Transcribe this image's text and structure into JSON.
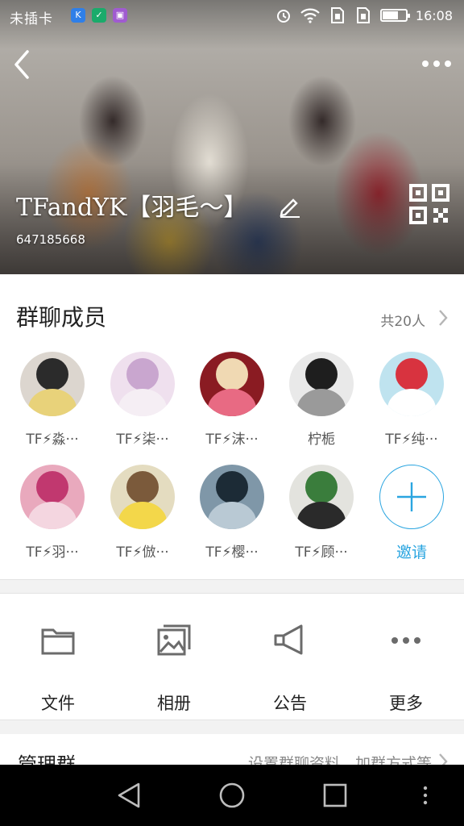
{
  "status_bar": {
    "carrier": "未插卡",
    "time": "16:08",
    "battery_level": 0.7,
    "app_icons": [
      {
        "name": "k-app-icon",
        "color": "#2f7fe8",
        "glyph": "K"
      },
      {
        "name": "shield-app-icon",
        "color": "#1aab6b",
        "glyph": "✓"
      },
      {
        "name": "purple-app-icon",
        "color": "#a05bd0",
        "glyph": "▣"
      }
    ]
  },
  "header": {
    "group_name": "TFandYK【羽毛～】",
    "group_id": "647185668"
  },
  "members": {
    "title": "群聊成员",
    "count_text": "共20人",
    "row1": [
      {
        "name": "TF⚡淼···",
        "colors": [
          "#dcd6cf",
          "#2b2b2b",
          "#e8d27a"
        ]
      },
      {
        "name": "TF⚡柒···",
        "colors": [
          "#efe0ee",
          "#c9a6cf",
          "#f5eef4"
        ]
      },
      {
        "name": "TF⚡沫···",
        "colors": [
          "#8a1b22",
          "#f0d9b3",
          "#e86a83"
        ]
      },
      {
        "name": "柠栀",
        "colors": [
          "#e9e9e9",
          "#1e1e1e",
          "#9a9a9a"
        ]
      },
      {
        "name": "TF⚡纯···",
        "colors": [
          "#bfe3ef",
          "#d8333f",
          "#ffffff"
        ]
      }
    ],
    "row2": [
      {
        "name": "TF⚡羽···",
        "colors": [
          "#e9a9bd",
          "#c1386f",
          "#f4d6e0"
        ]
      },
      {
        "name": "TF⚡倣···",
        "colors": [
          "#e4dcc0",
          "#7b5a3b",
          "#f3d74a"
        ]
      },
      {
        "name": "TF⚡樱···",
        "colors": [
          "#7f97a8",
          "#1c2b36",
          "#b9c9d4"
        ]
      },
      {
        "name": "TF⚡顾···",
        "colors": [
          "#e3e3de",
          "#3a7d3c",
          "#2a2a2a"
        ]
      }
    ],
    "invite_label": "邀请"
  },
  "tools": [
    {
      "label": "文件",
      "icon": "folder-icon"
    },
    {
      "label": "相册",
      "icon": "album-icon"
    },
    {
      "label": "公告",
      "icon": "megaphone-icon"
    },
    {
      "label": "更多",
      "icon": "more-dots-icon"
    }
  ],
  "manage": {
    "title": "管理群",
    "hint": "设置群聊资料、加群方式等"
  },
  "colors": {
    "accent": "#2aa5e0",
    "icon_gray": "#6b6b6b"
  }
}
